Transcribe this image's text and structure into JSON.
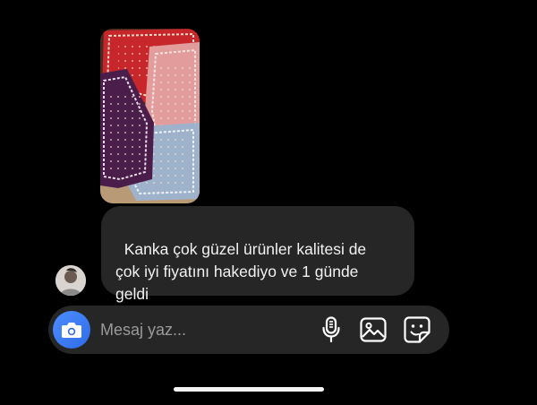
{
  "thread": {
    "incoming_photo": {
      "icon": "photo-bandanas"
    },
    "incoming_message": {
      "text": "Kanka çok güzel ürünler kalitesi de\nçok iyi fiyatını hakediyo ve 1 günde\ngeldi"
    },
    "sender_avatar": {
      "icon": "avatar-icon"
    }
  },
  "composer": {
    "placeholder": "Mesaj yaz...",
    "value": "",
    "camera_button": {
      "icon": "camera-icon",
      "color": "#3b82f6"
    },
    "mic_button": {
      "icon": "microphone-icon"
    },
    "gallery_button": {
      "icon": "gallery-icon"
    },
    "sticker_button": {
      "icon": "sticker-icon"
    }
  },
  "colors": {
    "background": "#000000",
    "bubble": "#262626",
    "accent": "#3b82f6",
    "placeholder": "#9a9a9a"
  }
}
